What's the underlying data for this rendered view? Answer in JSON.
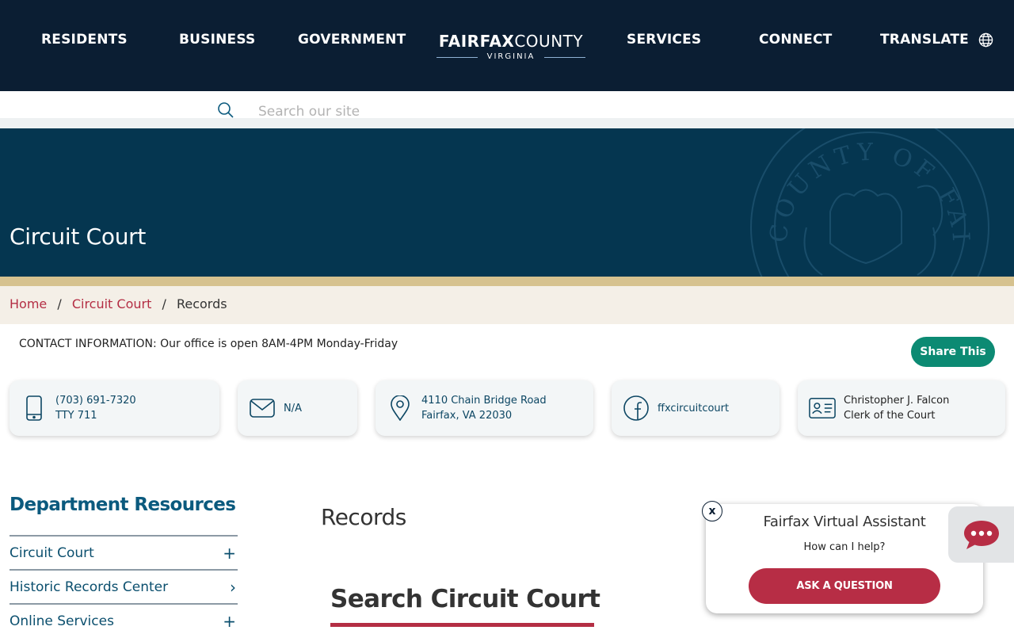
{
  "nav": {
    "items": [
      "RESIDENTS",
      "BUSINESS",
      "GOVERNMENT",
      "SERVICES",
      "CONNECT",
      "TRANSLATE"
    ],
    "logo": {
      "bold": "FAIRFAX",
      "light": "COUNTY",
      "sub": "VIRGINIA"
    }
  },
  "search": {
    "placeholder": "Search our site"
  },
  "banner": {
    "title": "Circuit Court",
    "seal_text": "COUNTY OF FAIRFAX"
  },
  "breadcrumb": {
    "home": "Home",
    "section": "Circuit Court",
    "current": "Records",
    "separator": "/"
  },
  "contact": {
    "line": "CONTACT INFORMATION: Our office is open 8AM-4PM Monday-Friday",
    "share_label": "Share This",
    "cards": [
      {
        "icon": "phone-icon",
        "line1": "(703) 691-7320",
        "line2": "TTY 711"
      },
      {
        "icon": "mail-icon",
        "line1": "N/A"
      },
      {
        "icon": "location-pin-icon",
        "line1": "4110 Chain Bridge Road",
        "line2": "Fairfax, VA 22030"
      },
      {
        "icon": "facebook-icon",
        "line1": "ffxcircuitcourt"
      },
      {
        "icon": "id-card-icon",
        "line1": "Christopher J. Falcon",
        "line2": "Clerk of the Court"
      }
    ]
  },
  "sidebar": {
    "title": "Department Resources",
    "items": [
      {
        "label": "Circuit Court",
        "icon": "+"
      },
      {
        "label": "Historic Records Center",
        "icon": "›"
      },
      {
        "label": "Online Services",
        "icon": "+"
      }
    ]
  },
  "main": {
    "heading": "Records",
    "section_title": "Search Circuit Court"
  },
  "assistant": {
    "title": "Fairfax Virtual Assistant",
    "subtitle": "How can I help?",
    "button": "ASK A QUESTION",
    "close": "x"
  },
  "colors": {
    "nav_bg": "#0b1e33",
    "banner_bg": "#053650",
    "gold": "#d6c28f",
    "accent_red": "#b42e44",
    "share_green": "#0c8a73",
    "link_blue": "#0b4f6e"
  }
}
